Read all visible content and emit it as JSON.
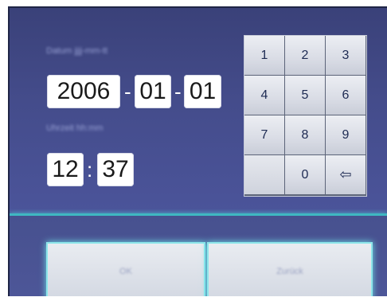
{
  "labels": {
    "date_label": "Datum jjjj-mm-tt",
    "time_label": "Uhrzeit hh:mm"
  },
  "date": {
    "year": "2006",
    "month": "01",
    "day": "01",
    "separator": "-"
  },
  "time": {
    "hour": "12",
    "minute": "37",
    "separator": ":"
  },
  "keypad": {
    "keys": [
      "1",
      "2",
      "3",
      "4",
      "5",
      "6",
      "7",
      "8",
      "9",
      "",
      "0",
      "⇦"
    ]
  },
  "buttons": {
    "ok": "OK",
    "back": "Zurück"
  },
  "colors": {
    "panel": "#444d8c",
    "accent_line": "#3fb7c2",
    "key": "#dcdfe7"
  }
}
